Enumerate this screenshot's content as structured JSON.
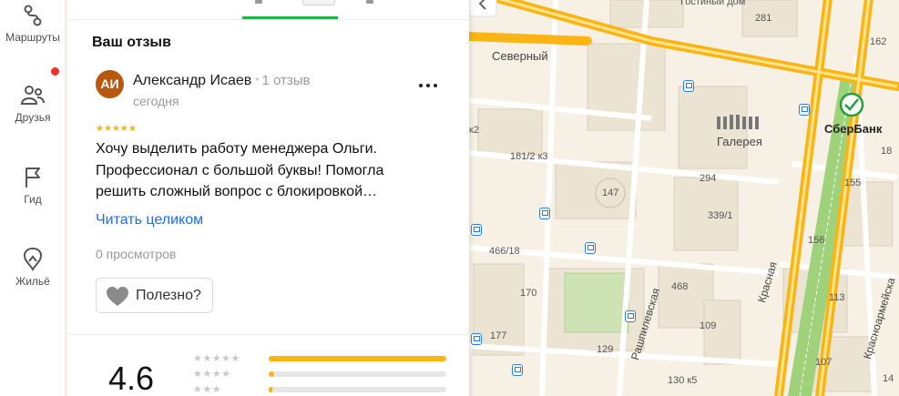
{
  "rail": {
    "items": [
      {
        "label": "Маршруты",
        "icon": "route-icon"
      },
      {
        "label": "Друзья",
        "icon": "friends-icon"
      },
      {
        "label": "Гид",
        "icon": "flag-icon"
      },
      {
        "label": "Жильё",
        "icon": "housing-icon"
      }
    ]
  },
  "review": {
    "section_title": "Ваш отзыв",
    "avatar_initials": "АИ",
    "author": "Александр Исаев",
    "review_count": "1 отзыв",
    "date": "сегодня",
    "stars": "★★★★★",
    "rating": 5,
    "text": "Хочу выделить работу менеджера Ольги. Профессионал с большой буквы! Помогла решить сложный вопрос с блокировкой…",
    "read_more": "Читать целиком",
    "views": "0 просмотров",
    "useful_label": "Полезно?"
  },
  "summary": {
    "rating": "4.6",
    "distribution": [
      {
        "stars": "★★★★★",
        "fraction": 1.0
      },
      {
        "stars": "★★★★",
        "fraction": 0.03
      },
      {
        "stars": "★★★",
        "fraction": 0.02
      }
    ]
  },
  "map": {
    "labels": {
      "severny": "Северный",
      "galereya": "Галерея",
      "sberbank": "СберБанк",
      "krasnaya": "Красная",
      "rashpilevskaya": "Рашпилевская",
      "krasnoarmeyskaya": "Красноармейска",
      "gostiny_dom": "Гостиный дом",
      "n281": "281",
      "n162": "162",
      "n147": "147",
      "n181": "181/2 к3",
      "n294": "294",
      "n339": "339/1",
      "n466": "466/18",
      "n170": "170",
      "n468": "468",
      "n156": "156",
      "n109": "109",
      "n113": "113",
      "n177": "177",
      "n129": "129",
      "n107": "107",
      "n130": "130 к5",
      "n155": "155",
      "k2": "к2",
      "n18": "18",
      "n14": "14"
    }
  },
  "colors": {
    "accent_green": "#21b14b",
    "link_blue": "#196dff",
    "star_yellow": "#f4b31a",
    "road_yellow": "#fcb415",
    "avatar_brown": "#b8570e",
    "notify_red": "#f0302b"
  }
}
